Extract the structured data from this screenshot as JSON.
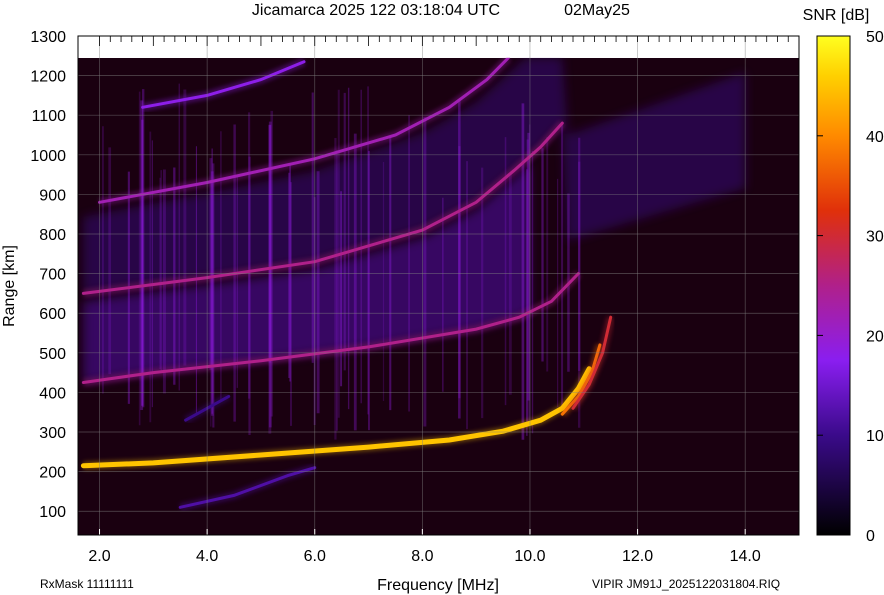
{
  "header": {
    "title": "Jicamarca 2025 122 03:18:04 UTC",
    "date": "02May25"
  },
  "footer": {
    "rxmask": "RxMask 11111111",
    "filename": "VIPIR  JM91J_2025122031804.RIQ"
  },
  "chart_data": {
    "type": "heatmap",
    "title": "Jicamarca 2025 122 03:18:04 UTC",
    "xlabel": "Frequency [MHz]",
    "ylabel": "Range [km]",
    "xlim": [
      1.6,
      15.0
    ],
    "ylim": [
      40,
      1300
    ],
    "x_ticks": [
      2.0,
      4.0,
      6.0,
      8.0,
      10.0,
      12.0,
      14.0
    ],
    "x_tick_labels": [
      "2.0",
      "4.0",
      "6.0",
      "8.0",
      "10.0",
      "12.0",
      "14.0"
    ],
    "y_ticks": [
      100,
      200,
      300,
      400,
      500,
      600,
      700,
      800,
      900,
      1000,
      1100,
      1200,
      1300
    ],
    "y_tick_labels": [
      "100",
      "200",
      "300",
      "400",
      "500",
      "600",
      "700",
      "800",
      "900",
      "1000",
      "1100",
      "1200",
      "1300"
    ],
    "data_range_max_km": 1245,
    "grid": true,
    "colorbar": {
      "label": "SNR [dB]",
      "min": 0,
      "max": 50,
      "ticks": [
        0,
        10,
        20,
        30,
        40,
        50
      ],
      "tick_labels": [
        "0",
        "10",
        "20",
        "30",
        "40",
        "50"
      ]
    },
    "traces": [
      {
        "name": "F-layer echo",
        "snr_db": 45,
        "points": [
          [
            1.7,
            215
          ],
          [
            3.0,
            222
          ],
          [
            5.0,
            242
          ],
          [
            7.0,
            262
          ],
          [
            8.5,
            280
          ],
          [
            9.5,
            302
          ],
          [
            10.2,
            330
          ],
          [
            10.6,
            360
          ],
          [
            10.9,
            410
          ],
          [
            11.1,
            460
          ]
        ]
      },
      {
        "name": "F-layer echo 2",
        "snr_db": 38,
        "points": [
          [
            10.6,
            345
          ],
          [
            10.9,
            390
          ],
          [
            11.15,
            450
          ],
          [
            11.3,
            520
          ]
        ]
      },
      {
        "name": "F-layer echo 3",
        "snr_db": 30,
        "points": [
          [
            10.8,
            360
          ],
          [
            11.1,
            420
          ],
          [
            11.35,
            500
          ],
          [
            11.5,
            590
          ]
        ]
      },
      {
        "name": "second hop",
        "snr_db": 25,
        "points": [
          [
            1.7,
            425
          ],
          [
            3.0,
            450
          ],
          [
            5.0,
            480
          ],
          [
            7.0,
            515
          ],
          [
            9.0,
            560
          ],
          [
            9.8,
            590
          ],
          [
            10.4,
            630
          ],
          [
            10.9,
            700
          ]
        ]
      },
      {
        "name": "third hop",
        "snr_db": 25,
        "points": [
          [
            1.7,
            650
          ],
          [
            4.0,
            690
          ],
          [
            6.0,
            730
          ],
          [
            8.0,
            810
          ],
          [
            9.0,
            880
          ],
          [
            9.7,
            960
          ],
          [
            10.2,
            1020
          ],
          [
            10.6,
            1080
          ]
        ]
      },
      {
        "name": "fourth hop",
        "snr_db": 22,
        "points": [
          [
            2.0,
            880
          ],
          [
            4.0,
            930
          ],
          [
            6.0,
            990
          ],
          [
            7.5,
            1050
          ],
          [
            8.5,
            1120
          ],
          [
            9.2,
            1190
          ],
          [
            9.6,
            1245
          ]
        ]
      },
      {
        "name": "fifth hop",
        "snr_db": 18,
        "points": [
          [
            2.8,
            1120
          ],
          [
            4.0,
            1150
          ],
          [
            5.0,
            1190
          ],
          [
            5.8,
            1235
          ]
        ]
      },
      {
        "name": "low faint trace",
        "snr_db": 12,
        "points": [
          [
            3.5,
            110
          ],
          [
            4.5,
            140
          ],
          [
            5.5,
            190
          ],
          [
            6.0,
            210
          ]
        ]
      },
      {
        "name": "faint trace 2",
        "snr_db": 10,
        "points": [
          [
            3.6,
            330
          ],
          [
            4.4,
            390
          ]
        ]
      }
    ],
    "diffuse_regions": [
      {
        "name": "lower spread",
        "f_min": 1.7,
        "f_max": 10.0,
        "snr_db": 12
      },
      {
        "name": "upper spread",
        "f_min": 1.7,
        "f_max": 14.0,
        "snr_db": 10
      }
    ]
  }
}
